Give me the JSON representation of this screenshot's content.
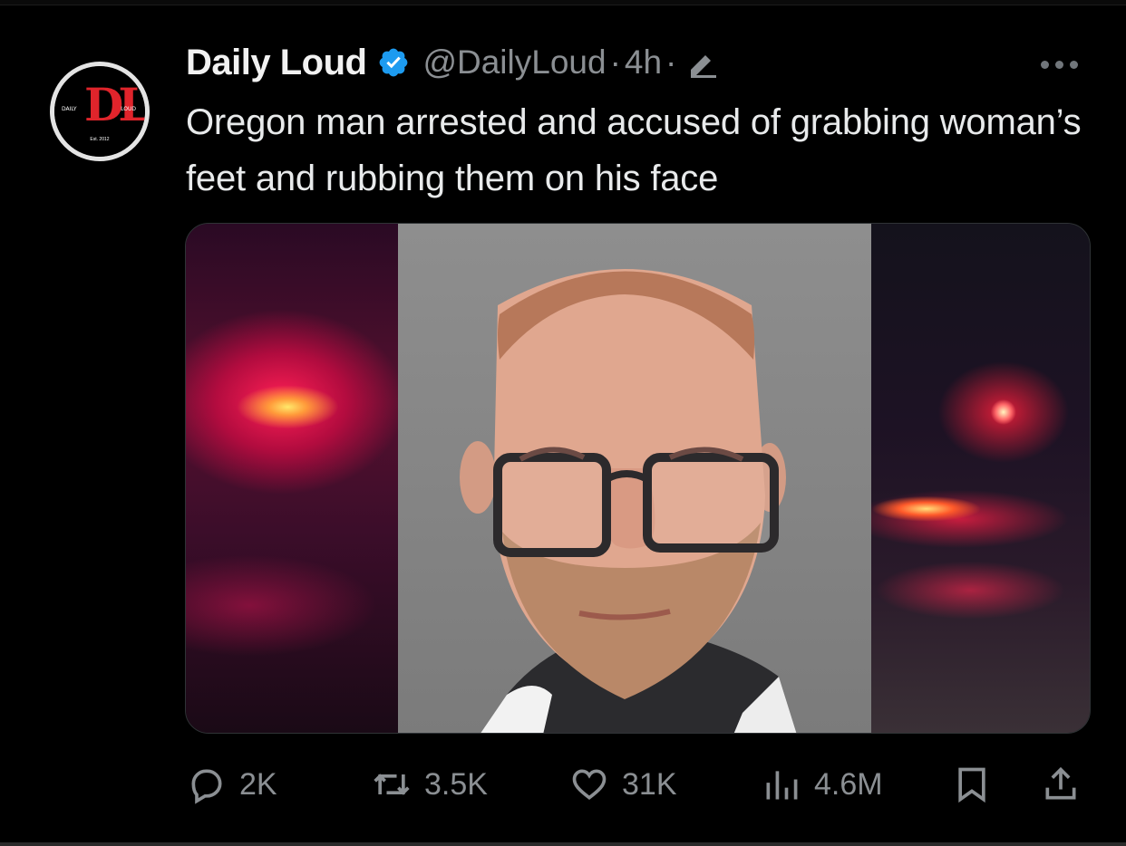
{
  "account": {
    "name": "Daily Loud",
    "handle": "@DailyLoud",
    "separator_1": "·",
    "time": "4h",
    "separator_2": "·",
    "avatar_text": {
      "mark": "DL",
      "left": "DAILY",
      "right": "LOUD",
      "established": "Est. 2012"
    }
  },
  "tweet": {
    "text": "Oregon man arrested and accused of grabbing woman’s feet and rubbing them on his face"
  },
  "stats": {
    "replies": "2K",
    "reposts": "3.5K",
    "likes": "31K",
    "views": "4.6M"
  },
  "icons": {
    "verified": "verified-badge-icon",
    "edit": "edit-pencil-icon",
    "more": "more-dots-icon",
    "reply": "reply-bubble-icon",
    "repost": "repost-arrows-icon",
    "like": "heart-icon",
    "views": "views-bars-icon",
    "bookmark": "bookmark-icon",
    "share": "share-upload-icon"
  },
  "colors": {
    "background": "#000000",
    "text_primary": "#e7e9ea",
    "text_secondary": "#8b8f93",
    "verified_blue": "#1d9bf0",
    "brand_red": "#e0242b"
  }
}
